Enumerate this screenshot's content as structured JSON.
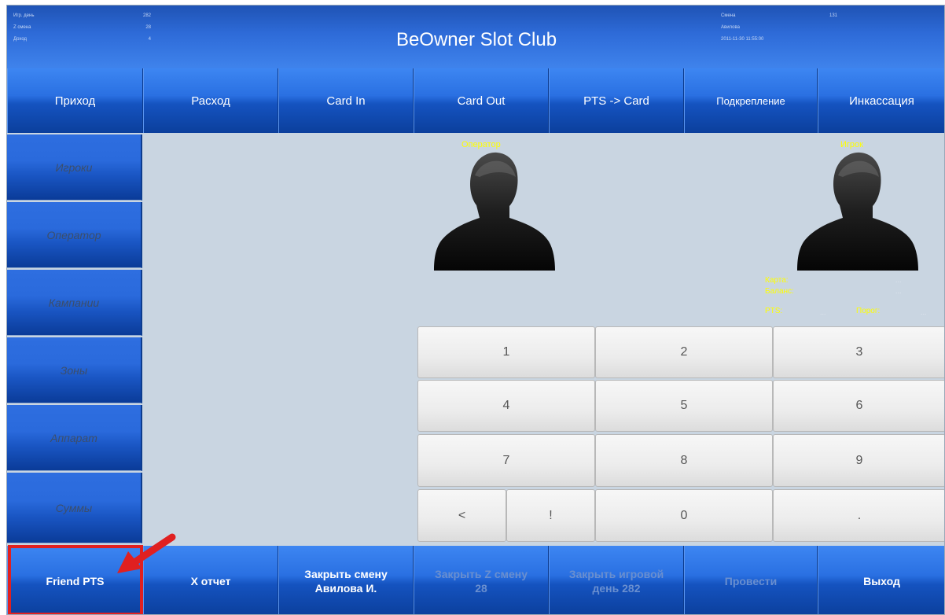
{
  "header": {
    "title": "BeOwner Slot Club",
    "left_stats": [
      {
        "label": "Игр. день",
        "value": "282"
      },
      {
        "label": "Z смена",
        "value": "28"
      },
      {
        "label": "Доход",
        "value": "4"
      }
    ],
    "right_stats": [
      {
        "label": "Смена",
        "value": "131"
      },
      {
        "label": "Авилова",
        "value": ""
      },
      {
        "label": "2011-11-30 11:55:00",
        "value": ""
      }
    ]
  },
  "topnav": [
    "Приход",
    "Расход",
    "Card In",
    "Card Out",
    "PTS -> Card",
    "Подкрепление",
    "Инкассация"
  ],
  "sidebar": [
    "Игроки",
    "Оператор",
    "Кампании",
    "Зоны",
    "Аппарат",
    "Суммы"
  ],
  "operator": {
    "label": "Оператор"
  },
  "player": {
    "label": "Игрок"
  },
  "player_info": {
    "card_label": "Карта:",
    "card_value": "...",
    "balance_label": "Баланс:",
    "balance_value": "...",
    "pts_label": "PTS:",
    "pts_value": "...",
    "threshold_label": "Порог:",
    "threshold_value": "..."
  },
  "keypad": {
    "k1": "1",
    "k2": "2",
    "k3": "3",
    "k4": "4",
    "k5": "5",
    "k6": "6",
    "k7": "7",
    "k8": "8",
    "k9": "9",
    "back": "<",
    "excl": "!",
    "k0": "0",
    "dot": "."
  },
  "bottom": {
    "friend_pts": "Friend PTS",
    "x_report": "X отчет",
    "close_shift_1": "Закрыть смену",
    "close_shift_2": "Авилова И.",
    "close_z_1": "Закрыть Z смену",
    "close_z_2": "28",
    "close_day_1": "Закрыть игровой",
    "close_day_2": "день 282",
    "post": "Провести",
    "exit": "Выход"
  },
  "colors": {
    "accent": "#1a56c4",
    "highlight": "#e02020",
    "label_yellow": "#ffff00",
    "background": "#c9d5e1"
  }
}
